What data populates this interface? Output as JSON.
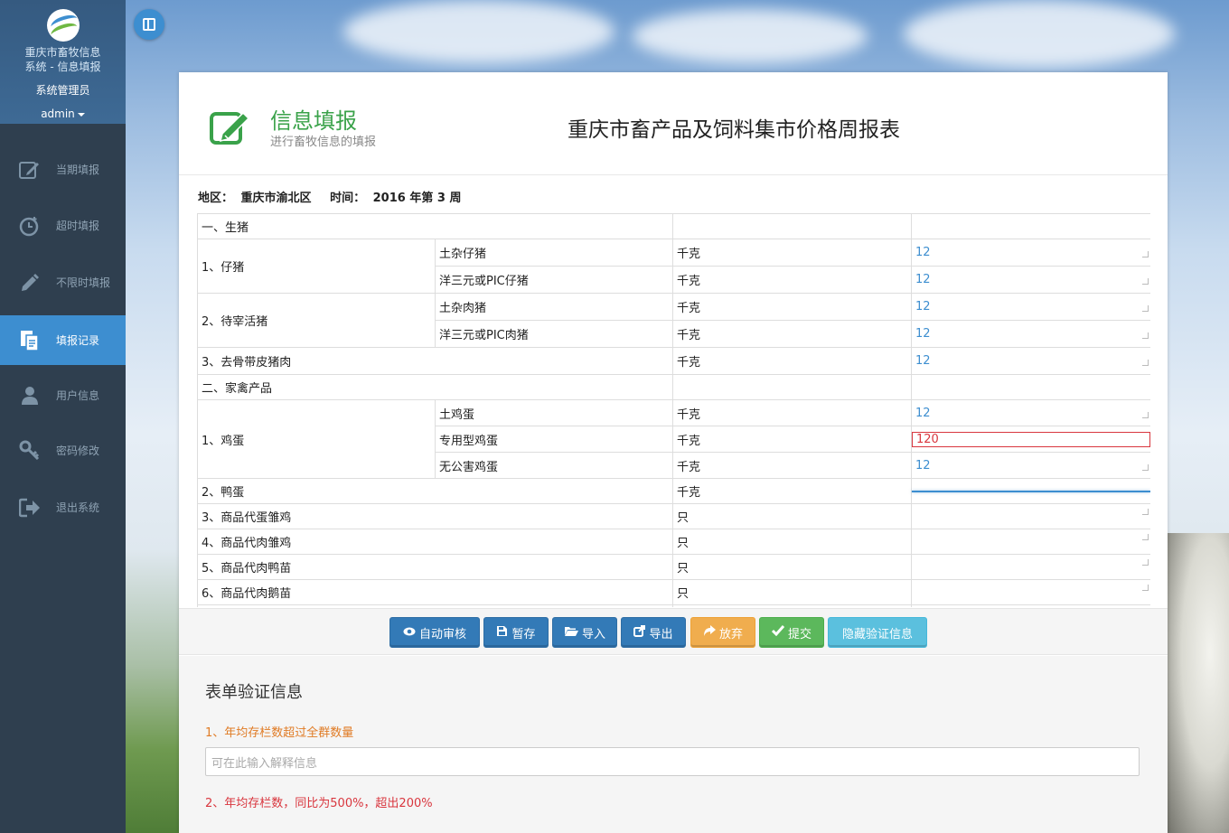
{
  "sidebar": {
    "brand_line1": "重庆市畜牧信息",
    "brand_line2": "系统 - 信息填报",
    "user_role": "系统管理员",
    "user_name": "admin",
    "items": [
      {
        "label": "当期填报",
        "icon": "edit-icon"
      },
      {
        "label": "超时填报",
        "icon": "clock-icon"
      },
      {
        "label": "不限时填报",
        "icon": "pencil-icon"
      },
      {
        "label": "填报记录",
        "icon": "files-icon",
        "active": true
      },
      {
        "label": "用户信息",
        "icon": "user-icon"
      },
      {
        "label": "密码修改",
        "icon": "key-icon"
      },
      {
        "label": "退出系统",
        "icon": "logout-icon"
      }
    ]
  },
  "header": {
    "title": "信息填报",
    "subtitle": "进行畜牧信息的填报",
    "form_title": "重庆市畜产品及饲料集市价格周报表"
  },
  "meta": {
    "region_label": "地区：",
    "region_value": "重庆市渝北区",
    "time_label": "时间：",
    "time_value": "2016 年第 3 周"
  },
  "table": {
    "sections": [
      {
        "title": "一、生猪",
        "groups": [
          {
            "name": "1、仔猪",
            "rows": [
              {
                "item": "土杂仔猪",
                "unit": "千克",
                "value": "12"
              },
              {
                "item": "洋三元或PIC仔猪",
                "unit": "千克",
                "value": "12"
              }
            ]
          },
          {
            "name": "2、待宰活猪",
            "rows": [
              {
                "item": "土杂肉猪",
                "unit": "千克",
                "value": "12"
              },
              {
                "item": "洋三元或PIC肉猪",
                "unit": "千克",
                "value": "12"
              }
            ]
          },
          {
            "name": "3、去骨带皮猪肉",
            "unit": "千克",
            "value": "12"
          }
        ]
      },
      {
        "title": "二、家禽产品",
        "groups": [
          {
            "name": "1、鸡蛋",
            "rows": [
              {
                "item": "土鸡蛋",
                "unit": "千克",
                "value": "12"
              },
              {
                "item": "专用型鸡蛋",
                "unit": "千克",
                "value": "120",
                "state": "error"
              },
              {
                "item": "无公害鸡蛋",
                "unit": "千克",
                "value": "12"
              }
            ]
          },
          {
            "name": "2、鸭蛋",
            "unit": "千克",
            "value": "",
            "state": "focus"
          },
          {
            "name": "3、商品代蛋雏鸡",
            "unit": "只",
            "value": ""
          },
          {
            "name": "4、商品代肉雏鸡",
            "unit": "只",
            "value": ""
          },
          {
            "name": "5、商品代肉鸭苗",
            "unit": "只",
            "value": ""
          },
          {
            "name": "6、商品代肉鹅苗",
            "unit": "只",
            "value": ""
          }
        ]
      }
    ]
  },
  "buttons": {
    "auto_review": "自动审核",
    "save_draft": "暂存",
    "import": "导入",
    "export": "导出",
    "discard": "放弃",
    "submit": "提交",
    "hide_validation": "隐藏验证信息"
  },
  "validation": {
    "title": "表单验证信息",
    "msg1": "1、年均存栏数超过全群数量",
    "explain_placeholder": "可在此输入解释信息",
    "msg2": "2、年均存栏数，同比为500%，超出200%"
  },
  "colors": {
    "sidebar_bg": "#2f3f4f",
    "active_blue": "#3d8ed0",
    "title_green": "#3aa24a",
    "error_red": "#d9363e",
    "warn_orange": "#e07b25"
  }
}
